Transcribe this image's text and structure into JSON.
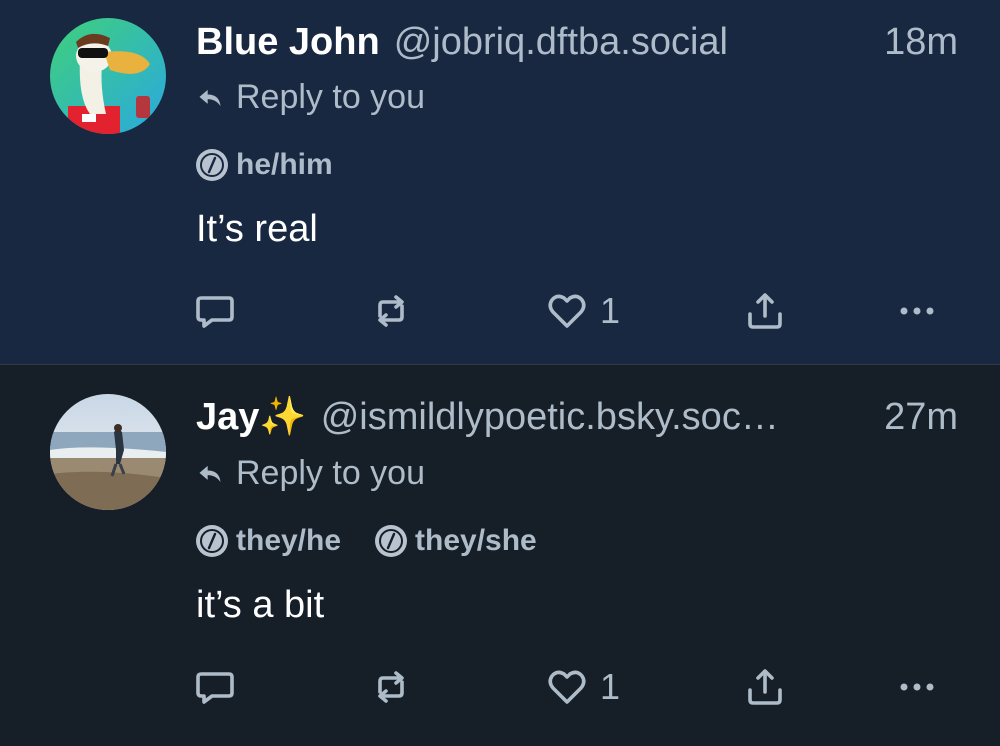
{
  "posts": [
    {
      "author_name": "Blue John",
      "handle": "@jobriq.dftba.social",
      "time": "18m",
      "reply_label": "Reply to you",
      "pronouns": [
        "he/him"
      ],
      "text": "It’s real",
      "like_count": "1",
      "avatar": "pelican-avatar"
    },
    {
      "author_name": "Jay✨",
      "handle": "@ismildlypoetic.bsky.soc…",
      "time": "27m",
      "reply_label": "Reply to you",
      "pronouns": [
        "they/he",
        "they/she"
      ],
      "text": "it’s a bit",
      "like_count": "1",
      "avatar": "beach-photo-avatar"
    }
  ],
  "colors": {
    "highlight_bg": "#192841",
    "page_bg": "#161e27",
    "muted_text": "#aebbc9"
  }
}
